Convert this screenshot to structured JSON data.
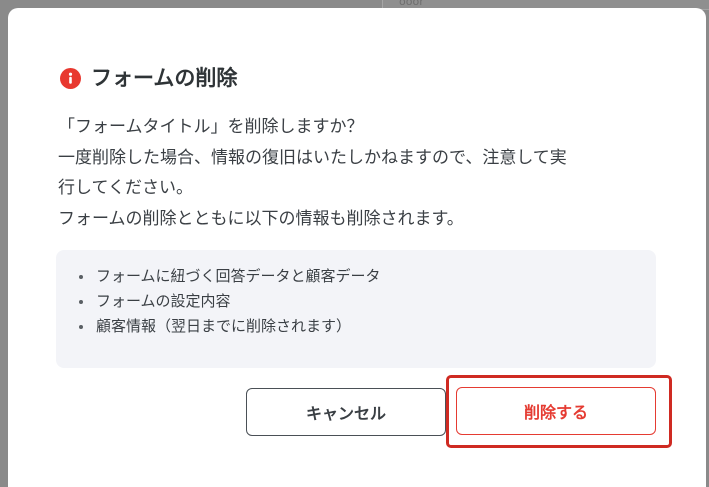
{
  "background": {
    "peek_text": "ooor"
  },
  "dialog": {
    "icon": "info-circle-icon",
    "title": "フォームの削除",
    "message_lines": [
      "「フォームタイトル」を削除しますか？",
      "一度削除した場合、情報の復旧はいたしかねますので、注意して実",
      "行してください。",
      "フォームの削除とともに以下の情報も削除されます。"
    ],
    "affected_items": [
      "フォームに紐づく回答データと顧客データ",
      "フォームの設定内容",
      "顧客情報（翌日までに削除されます）"
    ],
    "cancel_label": "キャンセル",
    "delete_label": "削除する"
  },
  "colors": {
    "danger": "#e53b32",
    "highlight_border": "#cf2a22",
    "text": "#3a3f44",
    "info_box_bg": "#f3f4f8"
  }
}
